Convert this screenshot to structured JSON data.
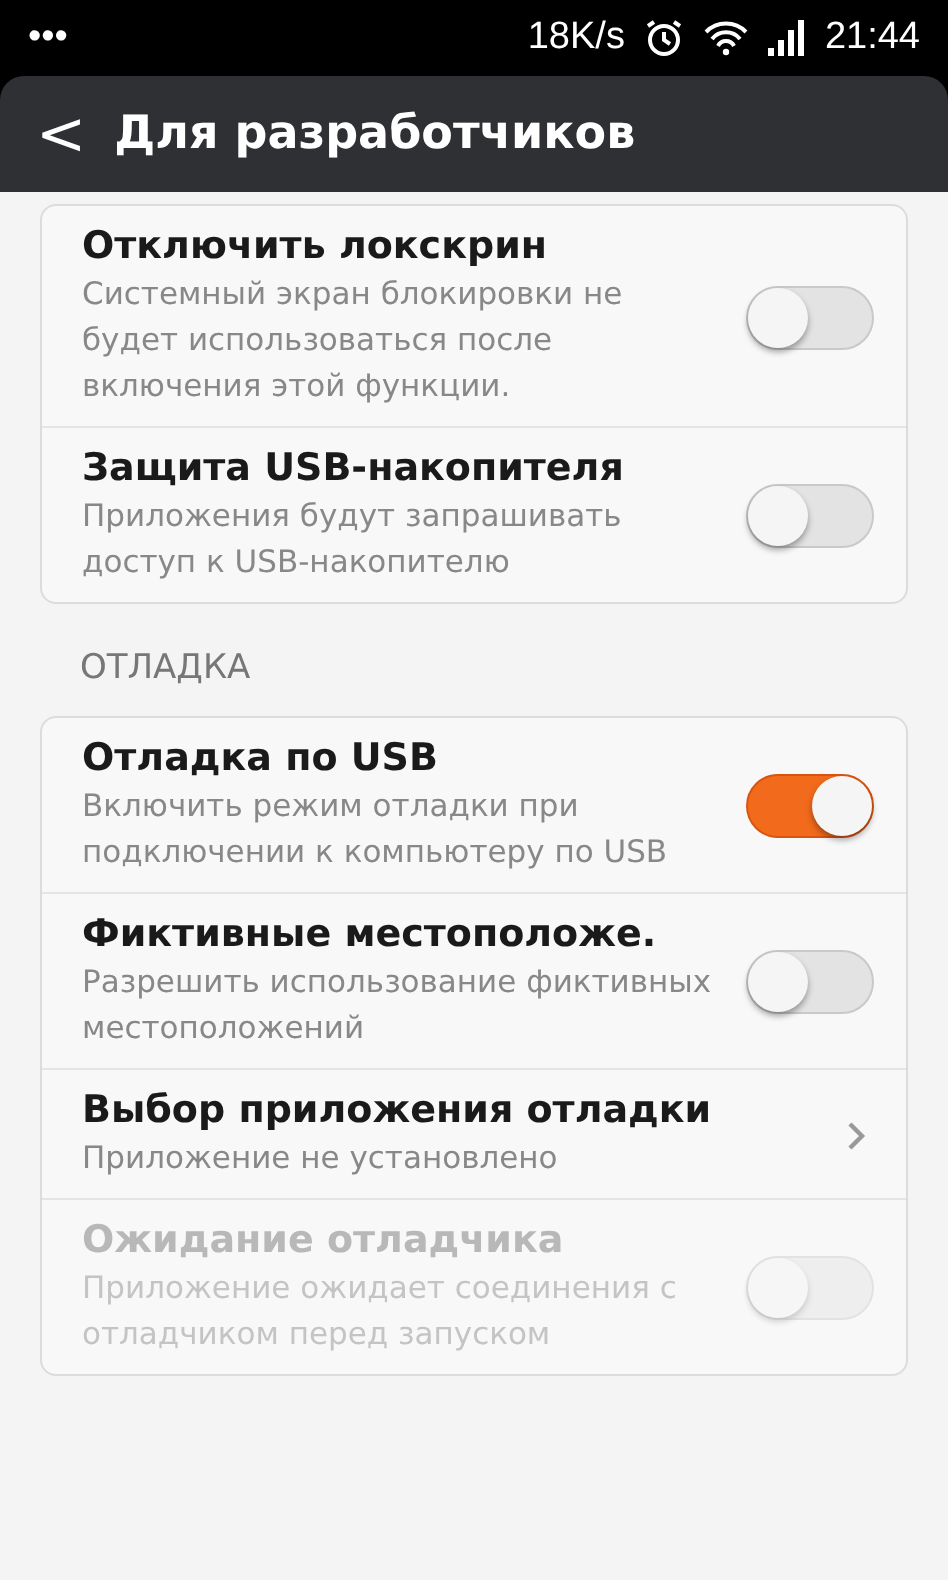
{
  "status_bar": {
    "notifications": "•••",
    "speed": "18K/s",
    "time": "21:44"
  },
  "header": {
    "back": "<",
    "title": "Для разработчиков"
  },
  "sections": [
    {
      "items": [
        {
          "kind": "toggle",
          "title": "Отключить локскрин",
          "subtitle": "Системный экран блокировки не будет использоваться после включения этой функции.",
          "on": false,
          "disabled": false
        },
        {
          "kind": "toggle",
          "title": "Защита USB-накопителя",
          "subtitle": "Приложения будут запрашивать доступ к USB-накопителю",
          "on": false,
          "disabled": false
        }
      ]
    },
    {
      "label": "ОТЛАДКА",
      "items": [
        {
          "kind": "toggle",
          "title": "Отладка по USB",
          "subtitle": "Включить режим отладки при подключении к компьютеру по USB",
          "on": true,
          "disabled": false
        },
        {
          "kind": "toggle",
          "title": "Фиктивные местоположе.",
          "subtitle": "Разрешить использование фиктивных местоположений",
          "on": false,
          "disabled": false
        },
        {
          "kind": "link",
          "title": "Выбор приложения отладки",
          "subtitle": "Приложение не установлено",
          "disabled": false
        },
        {
          "kind": "toggle",
          "title": "Ожидание отладчика",
          "subtitle": "Приложение ожидает соединения с отладчиком перед запуском",
          "on": false,
          "disabled": true
        }
      ]
    }
  ]
}
